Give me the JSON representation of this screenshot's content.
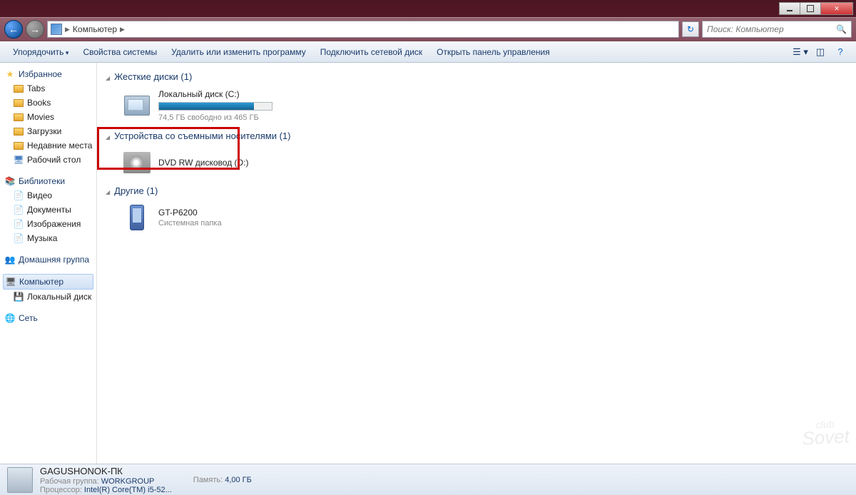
{
  "window": {
    "search_placeholder": "Поиск: Компьютер"
  },
  "breadcrumb": {
    "location": "Компьютер"
  },
  "toolbar": {
    "organize": "Упорядочить",
    "system_props": "Свойства системы",
    "uninstall": "Удалить или изменить программу",
    "map_drive": "Подключить сетевой диск",
    "control_panel": "Открыть панель управления"
  },
  "sidebar": {
    "favorites": "Избранное",
    "fav_items": [
      "Tabs",
      "Books",
      "Movies",
      "Загрузки",
      "Недавние места",
      "Рабочий стол"
    ],
    "libraries": "Библиотеки",
    "lib_items": [
      "Видео",
      "Документы",
      "Изображения",
      "Музыка"
    ],
    "homegroup": "Домашняя группа",
    "computer": "Компьютер",
    "local_disk": "Локальный диск (",
    "network": "Сеть"
  },
  "sections": {
    "hard_drives": "Жесткие диски (1)",
    "removable": "Устройства со съемными носителями (1)",
    "other": "Другие (1)"
  },
  "drives": {
    "local": {
      "name": "Локальный диск (C:)",
      "free": "74,5 ГБ свободно из 465 ГБ",
      "usage_pct": 84
    },
    "dvd": {
      "name": "DVD RW дисковод (D:)"
    },
    "device": {
      "name": "GT-P6200",
      "sub": "Системная папка"
    }
  },
  "status": {
    "computer_name": "GAGUSHONOK-ПК",
    "workgroup_label": "Рабочая группа:",
    "workgroup": "WORKGROUP",
    "cpu_label": "Процессор:",
    "cpu": "Intel(R) Core(TM) i5-52...",
    "memory_label": "Память:",
    "memory": "4,00 ГБ"
  },
  "watermark": {
    "top": "club",
    "main": "Sovet"
  }
}
